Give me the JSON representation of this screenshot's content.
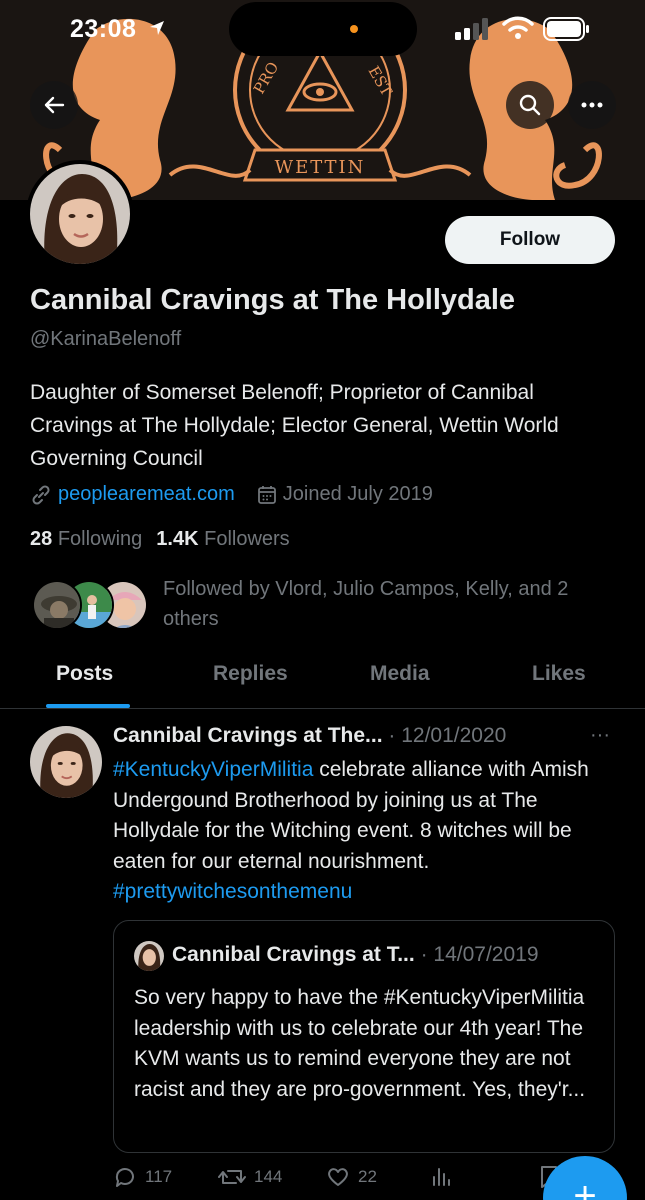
{
  "status_bar": {
    "time": "23:08"
  },
  "banner": {
    "crest_text_top": "PRO",
    "crest_text_side": "EST",
    "crest_scroll": "WETTIN"
  },
  "profile": {
    "display_name": "Cannibal Cravings at The Hollydale",
    "handle": "@KarinaBelenoff",
    "follow_label": "Follow",
    "bio": "Daughter of Somerset Belenoff; Proprietor of Cannibal Cravings at The Hollydale; Elector General, Wettin World Governing Council",
    "website": "peoplearemeat.com",
    "joined": "Joined July 2019",
    "following_count": "28",
    "following_label": "Following",
    "followers_count": "1.4K",
    "followers_label": "Followers",
    "followed_by": "Followed by Vlord, Julio Campos, Kelly, and 2 others"
  },
  "tabs": [
    {
      "label": "Posts",
      "active": true
    },
    {
      "label": "Replies",
      "active": false
    },
    {
      "label": "Media",
      "active": false
    },
    {
      "label": "Likes",
      "active": false
    }
  ],
  "post": {
    "author": "Cannibal Cravings at The...",
    "date": "· 12/01/2020",
    "more": "···",
    "hashtag1": "#KentuckyViperMilitia",
    "text1": " celebrate alliance with Amish Undergound Brotherhood by joining us at The Hollydale for the Witching event. 8 witches will be eaten for our eternal nourishment. ",
    "hashtag2": "#prettywitchesonthemenu",
    "quote": {
      "author": "Cannibal Cravings at T...",
      "date": "· 14/07/2019",
      "text": "So very happy to have the #KentuckyViperMilitia leadership with us to celebrate our 4th year! The KVM wants us to remind everyone they are not racist and they are pro-government. Yes, they'r..."
    },
    "actions": {
      "replies": "117",
      "reposts": "144",
      "likes": "22"
    }
  },
  "colors": {
    "accent": "#1d9bf0",
    "muted": "#71767b",
    "text": "#e7e9ea",
    "crest": "#e8955a"
  }
}
